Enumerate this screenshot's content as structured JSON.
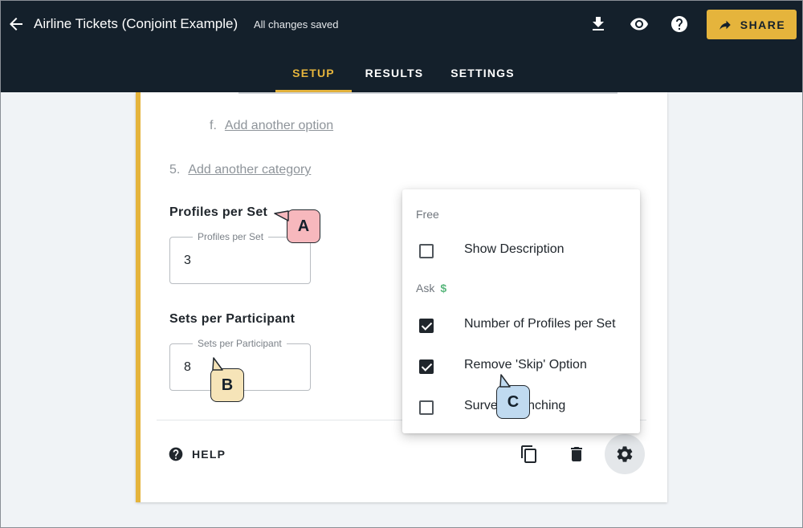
{
  "header": {
    "title": "Airline Tickets (Conjoint Example)",
    "save_status": "All changes saved",
    "share_label": "SHARE"
  },
  "tabs": [
    {
      "label": "SETUP",
      "active": true
    },
    {
      "label": "RESULTS",
      "active": false
    },
    {
      "label": "SETTINGS",
      "active": false
    }
  ],
  "card": {
    "option_row": {
      "marker": "f.",
      "link": "Add another option"
    },
    "category_row": {
      "marker": "5.",
      "link": "Add another category"
    },
    "profiles": {
      "label": "Profiles per Set",
      "field_label": "Profiles per Set",
      "value": "3"
    },
    "sets": {
      "label": "Sets per Participant",
      "field_label": "Sets per Participant",
      "value": "8"
    },
    "help_label": "HELP"
  },
  "menu": {
    "free_heading": "Free",
    "ask_heading": "Ask",
    "ask_badge": "$",
    "items": [
      {
        "label": "Show Description",
        "checked": false
      },
      {
        "label": "Number of Profiles per Set",
        "checked": true
      },
      {
        "label": "Remove 'Skip' Option",
        "checked": true
      },
      {
        "label": "Survey Branching",
        "checked": false
      }
    ]
  },
  "callouts": {
    "a": {
      "letter": "A",
      "color": "#f7b8bd"
    },
    "b": {
      "letter": "B",
      "color": "#f6e4b8"
    },
    "c": {
      "letter": "C",
      "color": "#c0daf0"
    }
  },
  "colors": {
    "topbar": "#14202b",
    "accent": "#e5b43c",
    "checkbox_checked": "#20262c",
    "badge_green": "#5ab77d"
  }
}
